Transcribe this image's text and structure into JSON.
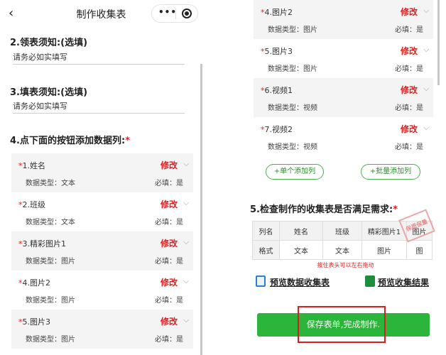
{
  "header": {
    "back_glyph": "‹",
    "title": "制作收集表",
    "more_glyph": "•••"
  },
  "section2": {
    "title": "2.领表须知:(选填)",
    "value": "请务必如实填写"
  },
  "section3": {
    "title": "3.填表须知:(选填)",
    "value": "请务必如实填写"
  },
  "section4": {
    "title": "4.点下面的按钮添加数据列:",
    "star": "*"
  },
  "fields": [
    {
      "name": "1.姓名",
      "type": "数据类型：文本",
      "required": "必填：是"
    },
    {
      "name": "2.班级",
      "type": "数据类型：文本",
      "required": "必填：是"
    },
    {
      "name": "3.精彩图片1",
      "type": "数据类型：图片",
      "required": "必填：是"
    },
    {
      "name": "4.图片2",
      "type": "数据类型：图片",
      "required": "必填：是"
    },
    {
      "name": "5.图片3",
      "type": "数据类型：图片",
      "required": "必填：是"
    },
    {
      "name": "6.视频1",
      "type": "数据类型：视频",
      "required": "必填：是"
    },
    {
      "name": "7.视频2",
      "type": "数据类型：视频",
      "required": "必填：是"
    }
  ],
  "field_star": "*",
  "edit_label": "修改",
  "chevron_glyph": "⌵",
  "buttons": {
    "add_single": "+单个添加列",
    "add_batch": "+批量添加列",
    "save": "保存表单,完成制作."
  },
  "section5": {
    "title": "5.检查制作的收集表是否满足需求:",
    "star": "*"
  },
  "preview_table": {
    "header": [
      "列名",
      "姓名",
      "班级",
      "精彩图片1",
      "图片"
    ],
    "row": [
      "格式",
      "文本",
      "文本",
      "图片",
      "图"
    ]
  },
  "stamp_text": "保质保量",
  "hint": "按住表头可以左右拖动",
  "links": {
    "preview_form": "预览数据收集表",
    "preview_result": "预览收集结果"
  },
  "colors": {
    "accent_red": "#e02020",
    "green": "#2bb53a",
    "highlight_box": "#d81e1e"
  }
}
